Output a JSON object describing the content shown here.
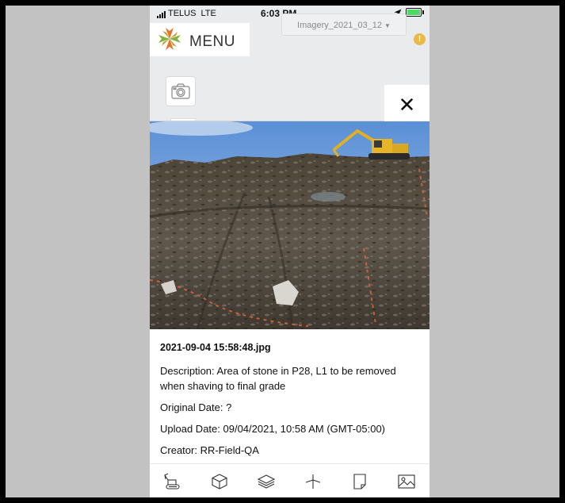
{
  "status_bar": {
    "carrier": "TELUS",
    "network": "LTE",
    "time": "6:03 PM"
  },
  "header": {
    "menu_label": "MENU",
    "imagery_select": {
      "value": "Imagery_2021_03_12"
    },
    "alert_symbol": "!"
  },
  "buttons": {
    "close_symbol": "✕"
  },
  "photo": {
    "file_name": "2021-09-04 15:58:48.jpg"
  },
  "details": {
    "description": "Description: Area of stone in P28, L1 to be removed when shaving to final grade",
    "original_date": "Original Date: ?",
    "upload_date": "Upload Date: 09/04/2021, 10:58 AM (GMT-05:00)",
    "creator": "Creator: RR-Field-QA"
  },
  "toolbar": {
    "icons": [
      "excavator-icon",
      "cube-icon",
      "layers-icon",
      "measure-icon",
      "document-icon",
      "image-icon"
    ]
  },
  "colors": {
    "accent_orange": "#e9b949",
    "background_gray": "#c2c2c2",
    "app_background": "#eaebec",
    "logo_orange": "#e2752b",
    "logo_green": "#7fb241"
  }
}
